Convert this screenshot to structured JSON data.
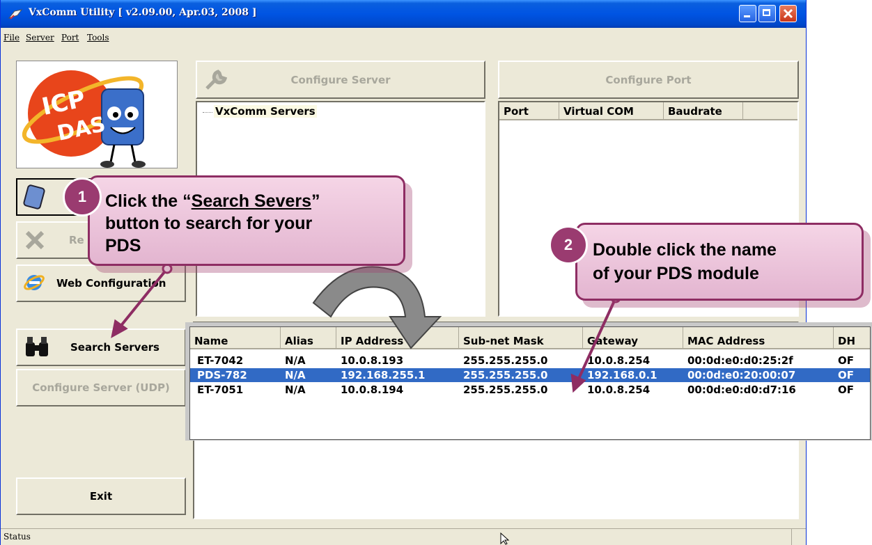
{
  "window": {
    "title": "VxComm Utility [ v2.09.00, Apr.03, 2008 ]"
  },
  "menu": {
    "items": [
      "File",
      "Server",
      "Port",
      "Tools"
    ]
  },
  "buttons": {
    "configure_server": "Configure Server",
    "configure_port": "Configure Port",
    "remove": "Re",
    "web_configuration": "Web Configuration",
    "search_servers": "Search Servers",
    "configure_server_udp": "Configure Server (UDP)",
    "exit": "Exit"
  },
  "tree": {
    "root": "VxComm Servers"
  },
  "port_table": {
    "columns": [
      "Port",
      "Virtual COM",
      "Baudrate"
    ]
  },
  "server_table": {
    "columns": [
      "Name",
      "Alias",
      "IP Address",
      "Sub-net Mask",
      "Gateway",
      "MAC Address",
      "DH"
    ],
    "rows": [
      [
        "ET-7042",
        "N/A",
        "10.0.8.193",
        "255.255.255.0",
        "10.0.8.254",
        "00:0d:e0:d0:25:2f",
        "OF"
      ],
      [
        "PDS-782",
        "N/A",
        "192.168.255.1",
        "255.255.255.0",
        "192.168.0.1",
        "00:0d:e0:20:00:07",
        "OF"
      ],
      [
        "ET-7051",
        "N/A",
        "10.0.8.194",
        "255.255.255.0",
        "10.0.8.254",
        "00:0d:e0:d0:d7:16",
        "OF"
      ]
    ],
    "selected_row": 1
  },
  "status": {
    "label": "Status"
  },
  "logo": {
    "line1": "ICP",
    "line2": "DAS"
  },
  "callouts": {
    "step1": {
      "number": "1",
      "prefix": "Click the “",
      "link": "Search Severs",
      "suffix": "”",
      "line2": "button to search for your",
      "line3": "PDS"
    },
    "step2": {
      "number": "2",
      "line1": "Double click the name",
      "line2": "of your PDS module"
    }
  },
  "colors": {
    "title_bar": "#0054e3",
    "selection": "#316ac5",
    "callout_border": "#8e2d63",
    "callout_fill": "#efc9dd"
  }
}
